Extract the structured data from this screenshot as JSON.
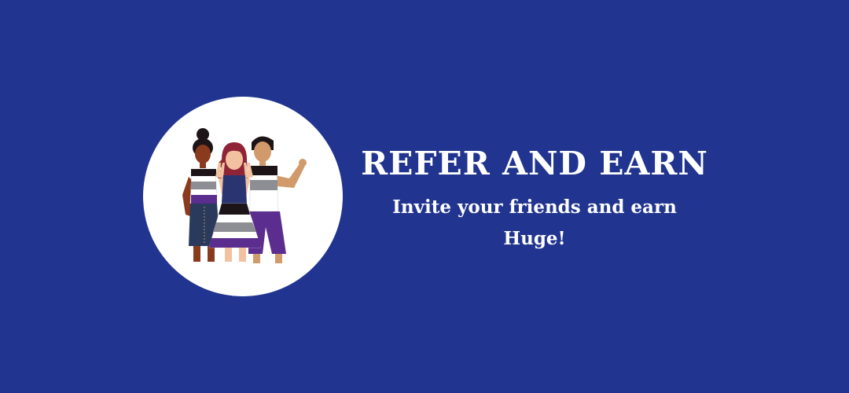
{
  "banner": {
    "title": "REFER AND EARN",
    "subtitle": "Invite your friends and earn Huge!",
    "illustration": "three-friends-illustration",
    "colors": {
      "background": "#213590",
      "circle": "#ffffff",
      "text": "#ffffff",
      "accent_purple": "#5b2d8e",
      "accent_navy": "#2a3470",
      "accent_gray": "#8d8d94"
    }
  }
}
